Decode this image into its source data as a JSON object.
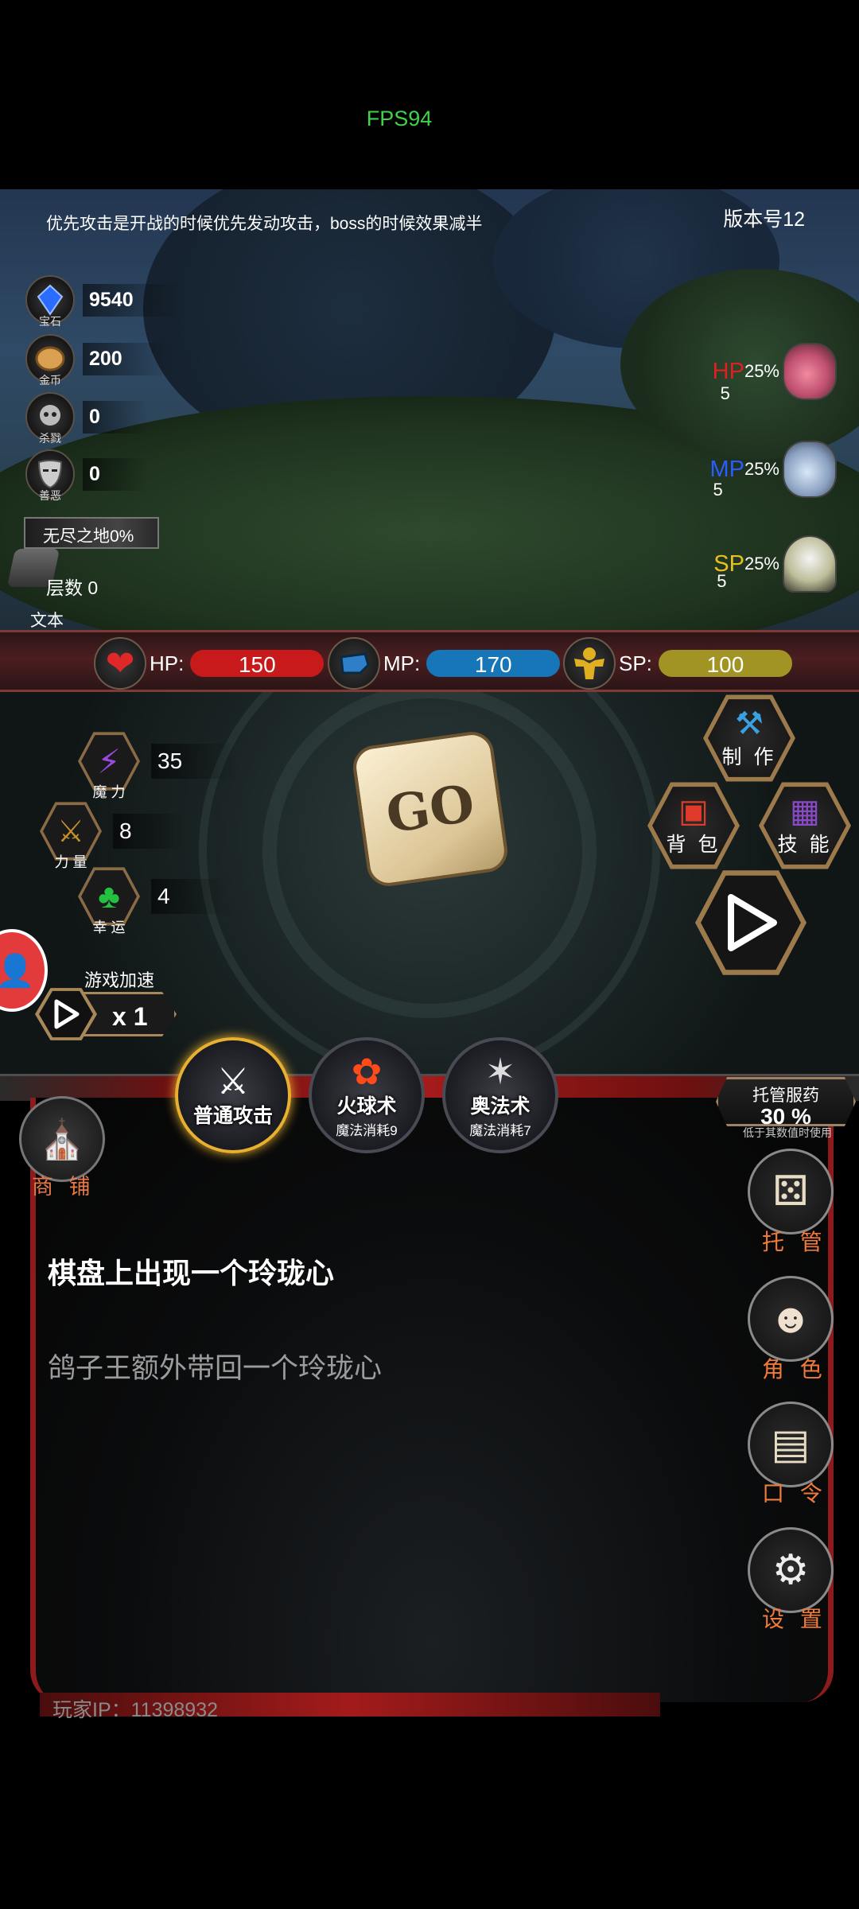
{
  "status": {
    "fps": "FPS94"
  },
  "top": {
    "tip": "优先攻击是开战的时候优先发动攻击，boss的时候效果减半",
    "version": "版本号12"
  },
  "resources": [
    {
      "icon": "gem-icon",
      "label": "宝石",
      "value": "9540"
    },
    {
      "icon": "coin-icon",
      "label": "金币",
      "value": "200"
    },
    {
      "icon": "skull-icon",
      "label": "杀戮",
      "value": "0"
    },
    {
      "icon": "mask-icon",
      "label": "善恶",
      "value": "0"
    }
  ],
  "zone": {
    "name": "无尽之地0%",
    "layer": "层数 0",
    "text": "文本"
  },
  "potions": [
    {
      "label": "HP",
      "color": "#e02020",
      "pct": "25%",
      "count": "5"
    },
    {
      "label": "MP",
      "color": "#2a5cff",
      "pct": "25%",
      "count": "5"
    },
    {
      "label": "SP",
      "color": "#e6c020",
      "pct": "25%",
      "count": "5"
    }
  ],
  "stats": {
    "hp": {
      "name": "HP:",
      "value": "150",
      "color": "#c81a1a"
    },
    "mp": {
      "name": "MP:",
      "value": "170",
      "color": "#1676b8"
    },
    "sp": {
      "name": "SP:",
      "value": "100",
      "color": "#a29424"
    }
  },
  "attributes": [
    {
      "label": "魔 力",
      "value": "35"
    },
    {
      "label": "力 量",
      "value": "8"
    },
    {
      "label": "幸 运",
      "value": "4"
    }
  ],
  "dice": {
    "label": "GO"
  },
  "actions": {
    "craft": "制 作",
    "bag": "背 包",
    "skill": "技 能"
  },
  "speed": {
    "label": "游戏加速",
    "multiplier": "x 1"
  },
  "skills": [
    {
      "name": "普通攻击",
      "cost": ""
    },
    {
      "name": "火球术",
      "cost": "魔法消耗9"
    },
    {
      "name": "奥法术",
      "cost": "魔法消耗7"
    }
  ],
  "shop": {
    "label": "商 铺"
  },
  "auto_med": {
    "title": "托管服药",
    "value": "30 %",
    "note": "低于其数值时使用"
  },
  "side_menu": [
    {
      "label": "托 管"
    },
    {
      "label": "角 色"
    },
    {
      "label": "口 令"
    },
    {
      "label": "设 置"
    }
  ],
  "log": {
    "line1": "棋盘上出现一个玲珑心",
    "line2": "鸽子王额外带回一个玲珑心"
  },
  "player": {
    "ip": "玩家IP：11398932"
  }
}
